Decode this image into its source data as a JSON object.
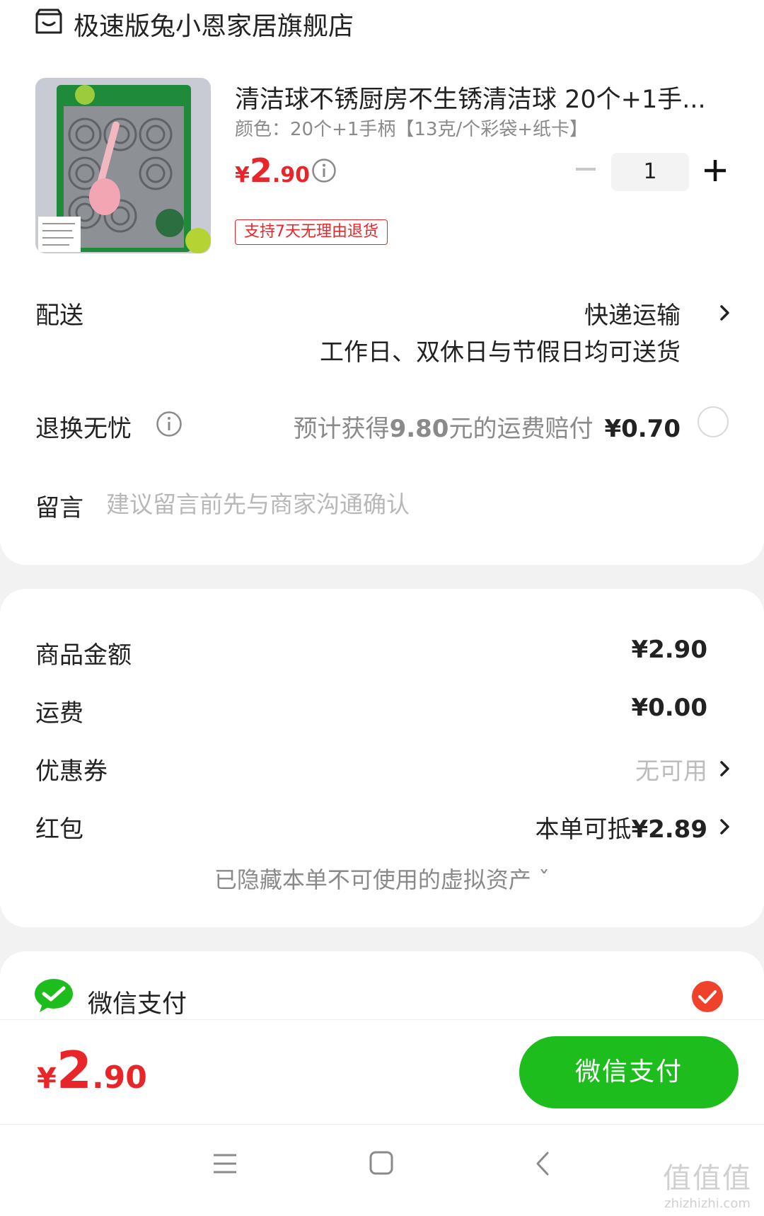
{
  "shop": {
    "name": "极速版兔小恩家居旗舰店",
    "icon": "store-icon"
  },
  "product": {
    "title": "清洁球不锈厨房不生锈清洁球 20个+1手...",
    "spec": "颜色：20个+1手柄【13克/个彩袋+纸卡】",
    "price_currency": "¥",
    "price_integer": "2",
    "price_decimal": ".90",
    "quantity": "1",
    "return_badge": "支持7天无理由退货"
  },
  "delivery": {
    "label": "配送",
    "method": "快递运输",
    "note": "工作日、双休日与节假日均可送货"
  },
  "returns": {
    "label": "退换无忧",
    "desc_prefix": "预计获得",
    "desc_amount": "9.80",
    "desc_suffix": "元的运费赔付",
    "fee": "¥0.70",
    "selected": false
  },
  "message": {
    "label": "留言",
    "placeholder": "建议留言前先与商家沟通确认"
  },
  "summary": {
    "goods_label": "商品金额",
    "goods_value": "¥2.90",
    "shipping_label": "运费",
    "shipping_value": "¥0.00",
    "coupon_label": "优惠券",
    "coupon_value": "无可用",
    "redpacket_label": "红包",
    "redpacket_prefix": "本单可抵",
    "redpacket_amount": "¥2.89",
    "hidden_assets": "已隐藏本单不可使用的虚拟资产 ˇ"
  },
  "payment": {
    "method_label": "微信支付",
    "method_selected": true,
    "total_currency": "¥",
    "total_integer": "2",
    "total_decimal": ".90",
    "pay_button": "微信支付"
  },
  "watermark": {
    "big": "值值值",
    "small": "zhizhizhi.com"
  },
  "colors": {
    "accent_red": "#e8262a",
    "wechat_green": "#1cbd1c"
  }
}
